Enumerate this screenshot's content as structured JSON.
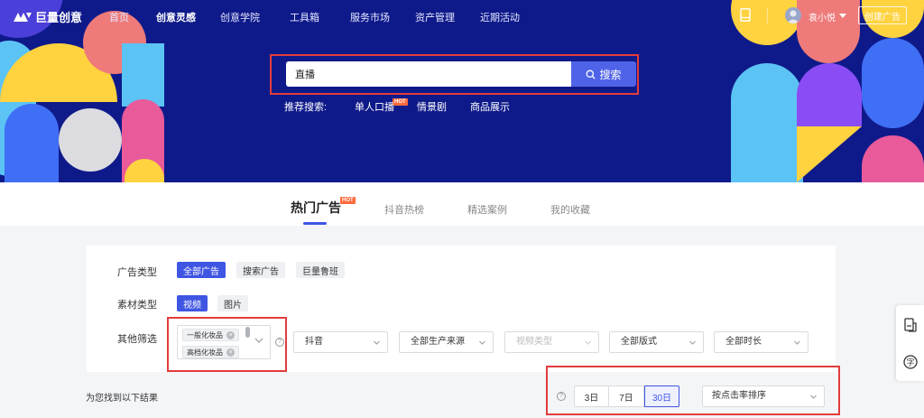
{
  "brand": {
    "name": "巨量创意"
  },
  "nav": {
    "items": [
      "首页",
      "创意灵感",
      "创意学院",
      "工具箱",
      "服务市场",
      "资产管理",
      "近期活动"
    ],
    "active_index": 1,
    "user_name": "袁小悦",
    "create_button": "创建广告"
  },
  "search": {
    "value": "直播",
    "button_label": "搜索"
  },
  "recommend": {
    "label": "推荐搜索:",
    "items": [
      "单人口播",
      "情景剧",
      "商品展示"
    ],
    "hot_badge": "HOT"
  },
  "tabs": {
    "items": [
      "热门广告",
      "抖音热榜",
      "精选案例",
      "我的收藏"
    ],
    "active_index": 0,
    "hot_badge": "HOT"
  },
  "filters": {
    "ad_type": {
      "label": "广告类型",
      "options": [
        "全部广告",
        "搜索广告",
        "巨量鲁班"
      ],
      "active_index": 0
    },
    "material_type": {
      "label": "素材类型",
      "options": [
        "视频",
        "图片"
      ],
      "active_index": 0
    },
    "other": {
      "label": "其他筛选",
      "tags": [
        "一般化妆品",
        "高档化妆品"
      ],
      "selects": [
        {
          "value": "抖音",
          "disabled": false
        },
        {
          "value": "全部生产来源",
          "disabled": false
        },
        {
          "value": "视频类型",
          "disabled": true
        },
        {
          "value": "全部版式",
          "disabled": false
        },
        {
          "value": "全部时长",
          "disabled": false
        }
      ]
    }
  },
  "results": {
    "text": "为您找到以下结果",
    "periods": [
      "3日",
      "7日",
      "30日"
    ],
    "active_period_index": 2,
    "sort_value": "按点击率排序"
  },
  "colors": {
    "hero_bg": "#0f1a8a",
    "accent": "#3f56e3",
    "search_button": "#4f63e8",
    "highlight_frame": "#e23c3c",
    "hot_badge": "#ff6a3d"
  }
}
